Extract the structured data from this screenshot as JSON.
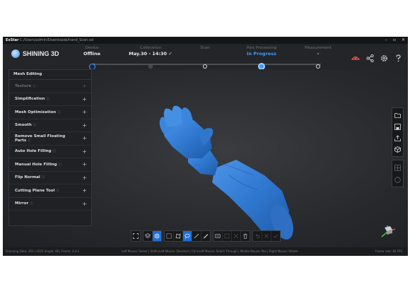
{
  "titlebar": {
    "app_name": "ExStar",
    "path": "C:/Users/admin/Downloads/hand_Scan.ssl",
    "minimize": "–",
    "maximize": "▫",
    "close": "✕"
  },
  "brand": {
    "name": "SHINING 3D"
  },
  "workflow": [
    {
      "label": "Device",
      "value": "Offline",
      "state": "done"
    },
    {
      "label": "Calibration",
      "value": "May.30 - 14:30",
      "state": "dim",
      "checked": true,
      "check_mark": "✔"
    },
    {
      "label": "Scan",
      "value": "",
      "state": "normal"
    },
    {
      "label": "Post Processing",
      "value": "In Progress",
      "state": "active"
    },
    {
      "label": "Measurement",
      "value": "-",
      "state": "normal"
    }
  ],
  "top_icons": [
    "scanner-settings-icon",
    "share-icon",
    "settings-gear-icon",
    "help-icon"
  ],
  "panel": {
    "title": "Mesh Editing",
    "items": [
      {
        "label": "Texture",
        "disabled": true
      },
      {
        "label": "Simplification",
        "disabled": false
      },
      {
        "label": "Mesh Optimization",
        "disabled": false
      },
      {
        "label": "Smooth",
        "disabled": false
      },
      {
        "label": "Remove Small Floating Parts",
        "disabled": false
      },
      {
        "label": "Auto Hole Filling",
        "disabled": false
      },
      {
        "label": "Manual Hole Filling",
        "disabled": false
      },
      {
        "label": "Flip Normal",
        "disabled": false
      },
      {
        "label": "Cutting Plane Tool",
        "disabled": false
      },
      {
        "label": "Mirror",
        "disabled": false
      }
    ],
    "info_glyph": "ⓘ",
    "plus_glyph": "+"
  },
  "right_tools": [
    "open-folder-icon",
    "save-icon",
    "export-icon",
    "view-cube-icon"
  ],
  "right_tools_2": [
    "mesh-view-icon",
    "texture-view-icon"
  ],
  "toolbar_icons": [
    "fit-view-icon",
    "layers-icon",
    "mesh-display-icon",
    "rect-select-icon",
    "poly-select-icon",
    "lasso-select-icon",
    "line-select-icon",
    "brush-select-icon",
    "invert-select-icon",
    "select-all-icon",
    "clear-select-icon",
    "delete-icon",
    "undo-icon",
    "redo-icon",
    "confirm-icon"
  ],
  "statusbar": {
    "left": "Scanning Data: 350 | 2025 Single: 48 | Frame: 3.4.1",
    "mid": "Left Mouse: Select | Shift+Left Mouse: Deselect | Ctrl+Left Mouse: Select Through | Middle Mouse: Pan | Right Mouse: Rotate",
    "right": "Frame rate: 60 FPS"
  },
  "colors": {
    "accent": "#3b9cff",
    "model": "#2f78d0",
    "bg": "#1d1f22"
  }
}
